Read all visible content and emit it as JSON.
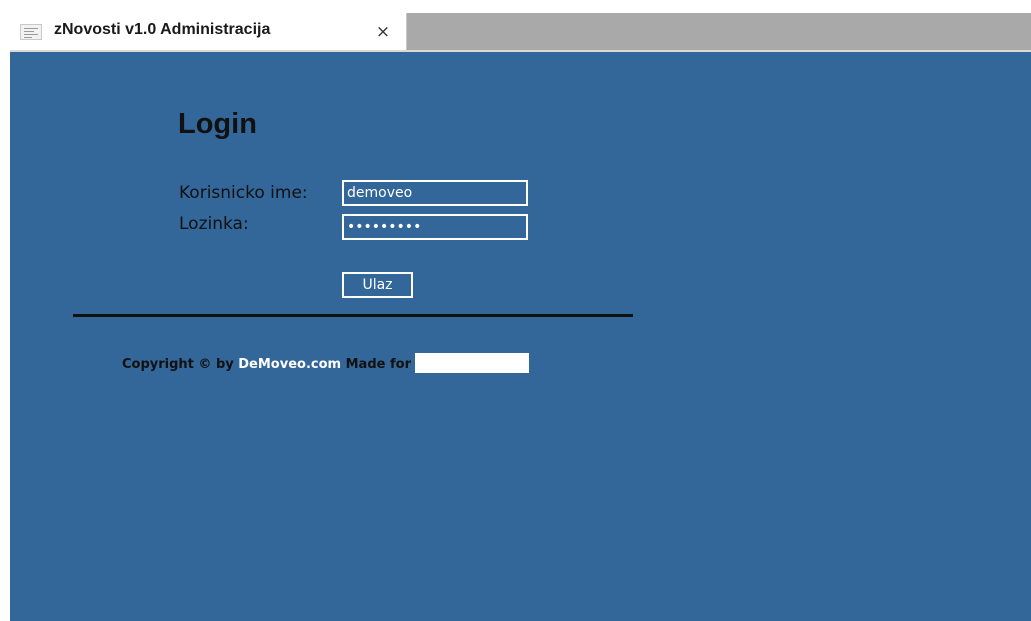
{
  "tab": {
    "title": "zNovosti v1.0 Administracija",
    "close_glyph": "×",
    "favicon": "page-thumbnail-icon",
    "close_icon": "close-icon"
  },
  "login": {
    "heading": "Login",
    "username_label": "Korisnicko ime:",
    "username_value": "demoveo",
    "password_label": "Lozinka:",
    "password_value": "•••••••••",
    "submit_label": "Ulaz"
  },
  "footer": {
    "prefix": "Copyright © by",
    "link_text": "DeMoveo.com",
    "made_for": "Made for"
  },
  "colors": {
    "background": "#336699",
    "text": "#111111",
    "tab_strip": "#a9a9a9"
  }
}
